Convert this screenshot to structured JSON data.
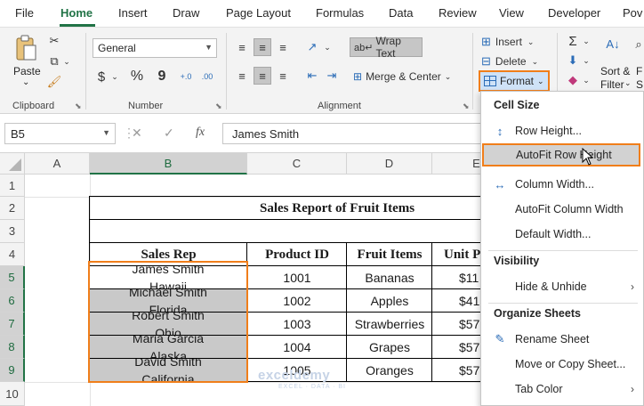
{
  "ribbon_tabs": [
    "File",
    "Home",
    "Insert",
    "Draw",
    "Page Layout",
    "Formulas",
    "Data",
    "Review",
    "View",
    "Developer",
    "Pov"
  ],
  "ribbon": {
    "clipboard": {
      "label": "Clipboard",
      "paste": "Paste",
      "paste_arrow": "⌄"
    },
    "font": {
      "name": "General",
      "label": "Number",
      "currency": "$",
      "percent": "%",
      "comma": "9",
      "inc_dec": "+.0",
      "dec_dec": ".00"
    },
    "alignment": {
      "label": "Alignment",
      "wrap_text": "Wrap Text",
      "merge_center": "Merge & Center"
    },
    "cells": {
      "insert": "Insert",
      "delete": "Delete",
      "format": "Format"
    },
    "editing": {
      "sort_filter_1": "Sort &",
      "sort_filter_2": "Filter",
      "find_1": "F",
      "find_2": "S"
    }
  },
  "formula_bar": {
    "name_box": "B5",
    "cancel": "✕",
    "enter": "✓",
    "fx": "fx",
    "content": "James Smith"
  },
  "columns": [
    "A",
    "B",
    "C",
    "D",
    "E"
  ],
  "rows": [
    "1",
    "2",
    "3",
    "4",
    "5",
    "6",
    "7",
    "8",
    "9",
    "10"
  ],
  "table": {
    "title": "Sales Report of Fruit Items",
    "headers": [
      "Sales Rep",
      "Product ID",
      "Fruit Items",
      "Unit P"
    ],
    "rows": [
      {
        "rep": "James Smith",
        "state": "Hawaii",
        "id": "1001",
        "fruit": "Bananas",
        "price": "$11"
      },
      {
        "rep": "Michael Smith",
        "state": "Florida",
        "id": "1002",
        "fruit": "Apples",
        "price": "$41"
      },
      {
        "rep": "Robert Smith",
        "state": "Ohio",
        "id": "1003",
        "fruit": "Strawberries",
        "price": "$57"
      },
      {
        "rep": "Maria Garcia",
        "state": "Alaska",
        "id": "1004",
        "fruit": "Grapes",
        "price": "$57"
      },
      {
        "rep": "David Smith",
        "state": "California",
        "id": "1005",
        "fruit": "Oranges",
        "price": "$57"
      }
    ]
  },
  "watermark": {
    "name": "exceldemy",
    "sub": "EXCEL · DATA · BI"
  },
  "format_menu": {
    "cell_size": "Cell Size",
    "row_height": "Row Height...",
    "autofit_row_height": "AutoFit Row Height",
    "column_width": "Column Width...",
    "autofit_column_width": "AutoFit Column Width",
    "default_width": "Default Width...",
    "visibility": "Visibility",
    "hide_unhide": "Hide & Unhide",
    "organize_sheets": "Organize Sheets",
    "rename_sheet": "Rename Sheet",
    "move_copy_sheet": "Move or Copy Sheet...",
    "tab_color": "Tab Color"
  },
  "colors": {
    "accent_green": "#217346",
    "highlight_orange": "#f07e1a",
    "selection_gray": "#c9c9c9",
    "icon_blue": "#2b6cb7"
  }
}
